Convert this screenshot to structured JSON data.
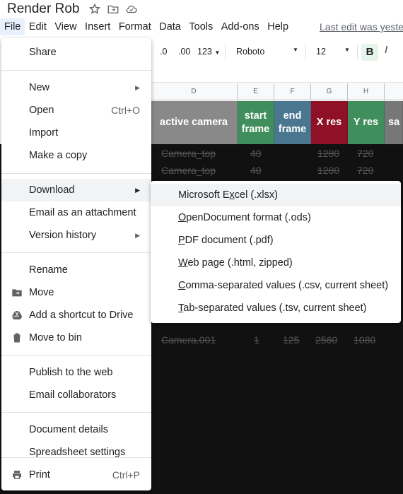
{
  "doc": {
    "title": "Render Rob",
    "last_edit": "Last edit was yeste"
  },
  "menubar": [
    "File",
    "Edit",
    "View",
    "Insert",
    "Format",
    "Data",
    "Tools",
    "Add-ons",
    "Help"
  ],
  "toolbar": {
    "dec_less": ".0",
    "dec_more": ".00",
    "format": "123",
    "font": "Roboto",
    "size": "12",
    "bold": "B",
    "italic": "I"
  },
  "columns": [
    "D",
    "E",
    "F",
    "G",
    "H"
  ],
  "header_cells": {
    "d": "active camera",
    "e": "start frame",
    "f": "end frame",
    "g": "X res",
    "h": "Y res",
    "i": "sa"
  },
  "rows": [
    [
      "Camera_top",
      "40",
      "",
      "1280",
      "720"
    ],
    [
      "Camera_top",
      "40",
      "",
      "1280",
      "720"
    ],
    [
      "Camera.001",
      "1",
      "125",
      "2560",
      "1080"
    ]
  ],
  "file_menu": {
    "share": "Share",
    "new": "New",
    "open": "Open",
    "open_shortcut": "Ctrl+O",
    "import": "Import",
    "make_copy": "Make a copy",
    "download": "Download",
    "email_attachment": "Email as an attachment",
    "version_history": "Version history",
    "rename": "Rename",
    "move": "Move",
    "add_shortcut": "Add a shortcut to Drive",
    "move_to_bin": "Move to bin",
    "publish": "Publish to the web",
    "email_collaborators": "Email collaborators",
    "doc_details": "Document details",
    "spreadsheet_settings": "Spreadsheet settings",
    "print": "Print",
    "print_shortcut": "Ctrl+P"
  },
  "download_menu": [
    {
      "pre": "Microsoft E",
      "u": "x",
      "post": "cel (.xlsx)"
    },
    {
      "pre": "",
      "u": "O",
      "post": "penDocument format (.ods)"
    },
    {
      "pre": "",
      "u": "P",
      "post": "DF document (.pdf)"
    },
    {
      "pre": "",
      "u": "W",
      "post": "eb page (.html, zipped)"
    },
    {
      "pre": "",
      "u": "C",
      "post": "omma-separated values (.csv, current sheet)"
    },
    {
      "pre": "",
      "u": "T",
      "post": "ab-separated values (.tsv, current sheet)"
    }
  ],
  "colors": {
    "header_d": "#898989",
    "header_e": "#3f8e5b",
    "header_f": "#4a7690",
    "header_g": "#8e1128",
    "header_h": "#3f8e5b",
    "header_i": "#777777",
    "highlight": "#f1f3f4"
  }
}
